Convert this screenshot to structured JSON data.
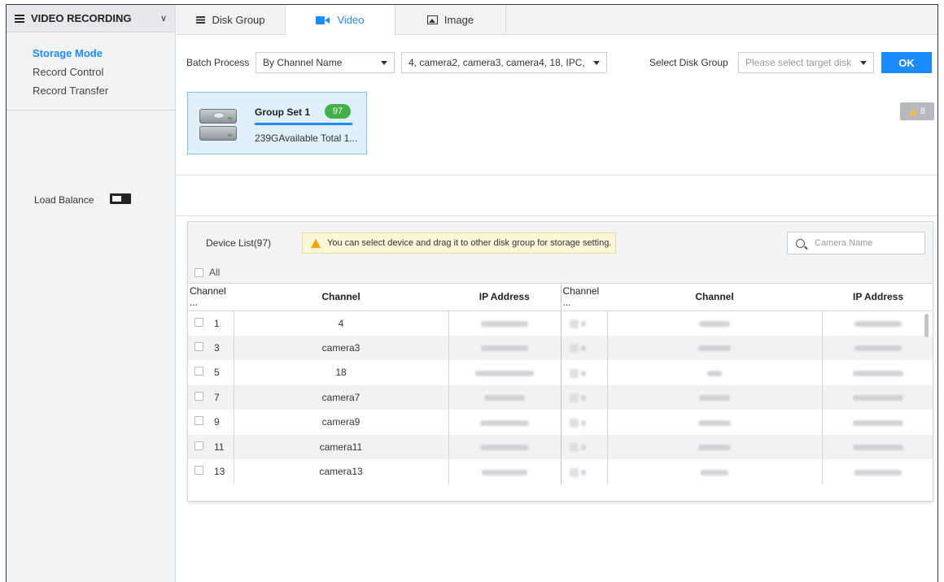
{
  "sidebar": {
    "header": "VIDEO RECORDING",
    "items": [
      {
        "label": "Storage Mode",
        "active": true
      },
      {
        "label": "Record Control",
        "active": false
      },
      {
        "label": "Record Transfer",
        "active": false
      }
    ]
  },
  "tabs": [
    {
      "label": "Disk Group",
      "icon": "list-icon",
      "active": false
    },
    {
      "label": "Video",
      "icon": "video-camera-icon",
      "active": true
    },
    {
      "label": "Image",
      "icon": "image-icon",
      "active": false
    }
  ],
  "toolbar": {
    "batch_label": "Batch Process",
    "batch_mode": "By Channel Name",
    "channels": "4, camera2, camera3, camera4, 18, IPC, cam...",
    "disk_group_label": "Select Disk Group",
    "disk_group_placeholder": "Please select target disk ...",
    "ok_label": "OK"
  },
  "disk_group": {
    "name": "Group Set 1",
    "count": "97",
    "size_text": "239GAvailable Total 1...",
    "usage_fraction": 1.0
  },
  "warning_badge": "8",
  "load_balance": {
    "label": "Load Balance",
    "enabled": false
  },
  "device_list": {
    "title": "Device List(97)",
    "hint": "You can select device and drag it to other disk group for storage setting.",
    "search_placeholder": "Camera Name",
    "all_label": "All",
    "columns": [
      "Channel ...",
      "Channel",
      "IP Address",
      "Channel ...",
      "Channel",
      "IP Address"
    ],
    "rows": [
      {
        "num": "1",
        "channel": "4"
      },
      {
        "num": "3",
        "channel": "camera3"
      },
      {
        "num": "5",
        "channel": "18"
      },
      {
        "num": "7",
        "channel": "camera7"
      },
      {
        "num": "9",
        "channel": "camera9"
      },
      {
        "num": "11",
        "channel": "camera11"
      },
      {
        "num": "13",
        "channel": "camera13"
      }
    ]
  },
  "colors": {
    "accent": "#1a8cff",
    "badge_green": "#43b04a",
    "hint_bg": "#fcf6d8"
  }
}
